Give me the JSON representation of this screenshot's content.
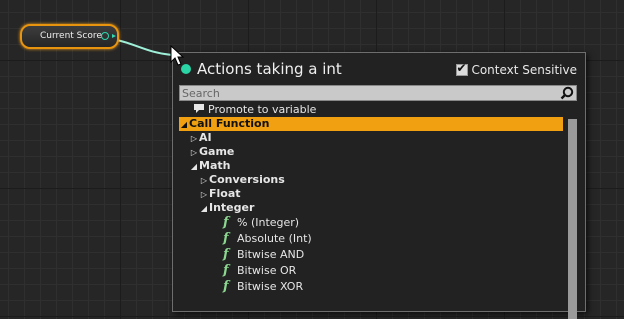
{
  "node": {
    "label": "Current Score"
  },
  "menu": {
    "title": "Actions taking a int",
    "context_sensitive_label": "Context Sensitive",
    "context_sensitive_checked": true,
    "search_placeholder": "Search",
    "items": [
      {
        "label": "Promote to variable",
        "kind": "action"
      },
      {
        "label": "Call Function",
        "kind": "category",
        "expanded": true,
        "selected": true
      },
      {
        "label": "AI",
        "kind": "category",
        "expanded": false
      },
      {
        "label": "Game",
        "kind": "category",
        "expanded": false
      },
      {
        "label": "Math",
        "kind": "category",
        "expanded": true
      },
      {
        "label": "Conversions",
        "kind": "category",
        "expanded": false
      },
      {
        "label": "Float",
        "kind": "category",
        "expanded": false
      },
      {
        "label": "Integer",
        "kind": "category",
        "expanded": true
      },
      {
        "label": "% (Integer)",
        "kind": "function"
      },
      {
        "label": "Absolute (Int)",
        "kind": "function"
      },
      {
        "label": "Bitwise AND",
        "kind": "function"
      },
      {
        "label": "Bitwise OR",
        "kind": "function"
      },
      {
        "label": "Bitwise XOR",
        "kind": "function"
      }
    ]
  },
  "colors": {
    "node_border": "#e8940e",
    "pin": "#2fd8b0",
    "selection": "#f0a011",
    "function_icon": "#8cd790"
  },
  "icons": {
    "pin": "circle-pin-icon",
    "search": "magnifier-icon",
    "function": "function-f-icon",
    "promote": "speech-bubble-icon"
  }
}
